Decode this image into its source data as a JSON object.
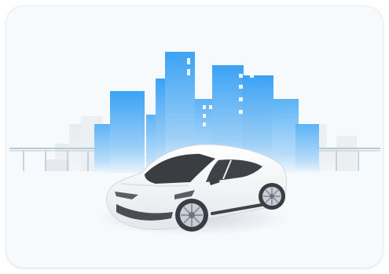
{
  "illustration": {
    "subject": "car-in-city-icon",
    "colors": {
      "card_background": "#f7fafd",
      "building_blue_top": "#3aa3f5",
      "building_blue_bottom": "#cfe8fb",
      "building_grey": "#e3e7eb",
      "bridge": "#b8c7d6",
      "car_body": "#f4f5f7",
      "car_glass": "#3a3d42",
      "ground_shadow": "#dde3e9"
    }
  }
}
